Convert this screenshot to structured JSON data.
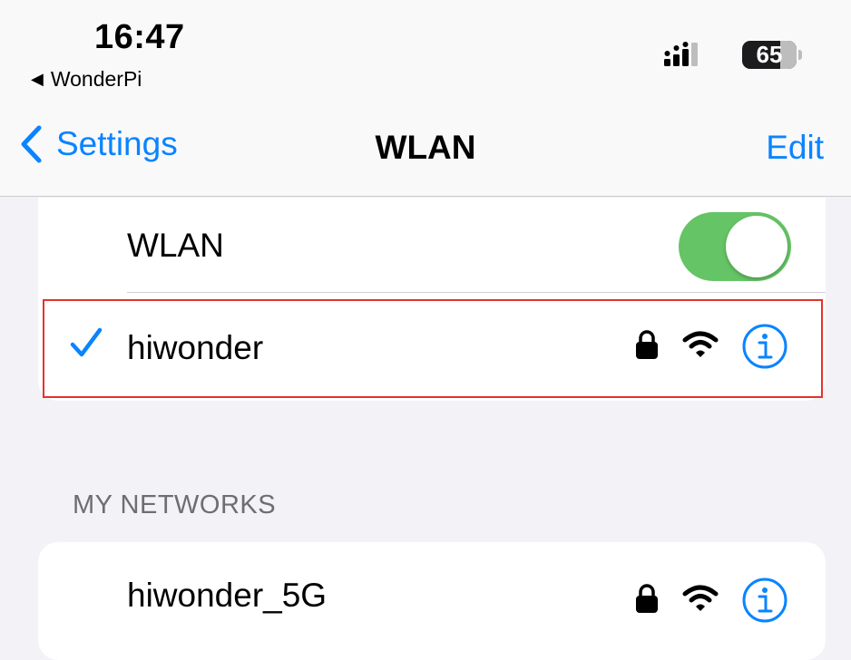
{
  "status_bar": {
    "time": "16:47",
    "back_app": "WonderPi",
    "battery": "65"
  },
  "nav": {
    "back_label": "Settings",
    "title": "WLAN",
    "edit_label": "Edit"
  },
  "wlan_toggle": {
    "label": "WLAN",
    "on": true
  },
  "connected_network": {
    "name": "hiwonder",
    "secured": true,
    "selected": true
  },
  "my_networks": {
    "header": "MY NETWORKS",
    "items": [
      {
        "name": "hiwonder_5G",
        "secured": true
      }
    ]
  },
  "colors": {
    "accent": "#0a84ff",
    "toggle_on": "#65c466",
    "highlight": "#e5322d"
  }
}
